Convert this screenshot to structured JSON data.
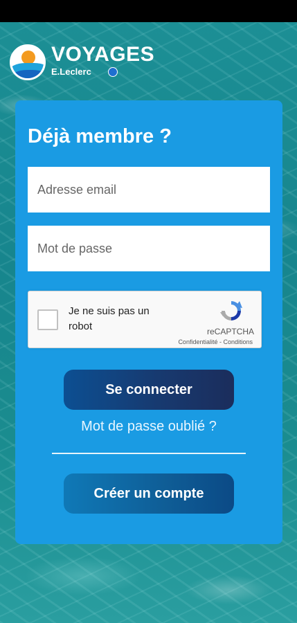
{
  "brand": {
    "name": "VOYAGES",
    "sub": "E.Leclerc"
  },
  "login": {
    "title": "Déjà membre ?",
    "email_placeholder": "Adresse email",
    "password_placeholder": "Mot de passe",
    "submit_label": "Se connecter",
    "forgot_label": "Mot de passe oublié ?",
    "create_label": "Créer un compte"
  },
  "captcha": {
    "label": "Je ne suis pas un robot",
    "brand": "reCAPTCHA",
    "legal": "Confidentialité - Conditions"
  },
  "colors": {
    "card": "#1a9be3",
    "login_button": "#173a70",
    "create_button": "#0f5d96"
  },
  "icons": {
    "logo": "voyages-sun-sea-logo",
    "captcha": "recaptcha-logo-icon"
  }
}
